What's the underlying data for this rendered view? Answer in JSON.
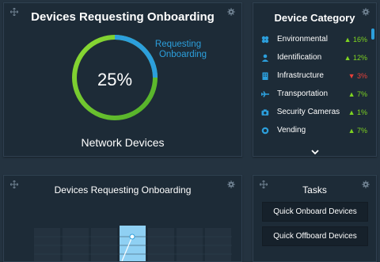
{
  "onboarding_panel": {
    "title": "Devices Requesting Onboarding",
    "value": "25%",
    "progress": 0.25,
    "legend_line1": "Requesting",
    "legend_line2": "Onboarding",
    "footer": "Network Devices"
  },
  "category_panel": {
    "title": "Device Category",
    "items": [
      {
        "name": "Environmental",
        "trend": "16%",
        "direction": "up",
        "icon": "fan-icon"
      },
      {
        "name": "Identification",
        "trend": "12%",
        "direction": "up",
        "icon": "person-icon"
      },
      {
        "name": "Infrastructure",
        "trend": "3%",
        "direction": "down",
        "icon": "building-icon"
      },
      {
        "name": "Transportation",
        "trend": "7%",
        "direction": "up",
        "icon": "plane-icon"
      },
      {
        "name": "Security Cameras",
        "trend": "1%",
        "direction": "up",
        "icon": "camera-icon"
      },
      {
        "name": "Vending",
        "trend": "7%",
        "direction": "up",
        "icon": "vending-icon"
      }
    ]
  },
  "chart_panel": {
    "title": "Devices Requesting Onboarding"
  },
  "tasks_panel": {
    "title": "Tasks",
    "buttons": [
      "Quick Onboard Devices",
      "Quick Offboard Devices"
    ]
  },
  "colors": {
    "accent_blue": "#2c9fdc",
    "accent_green": "#7ed321",
    "trend_down": "#e8403a"
  }
}
